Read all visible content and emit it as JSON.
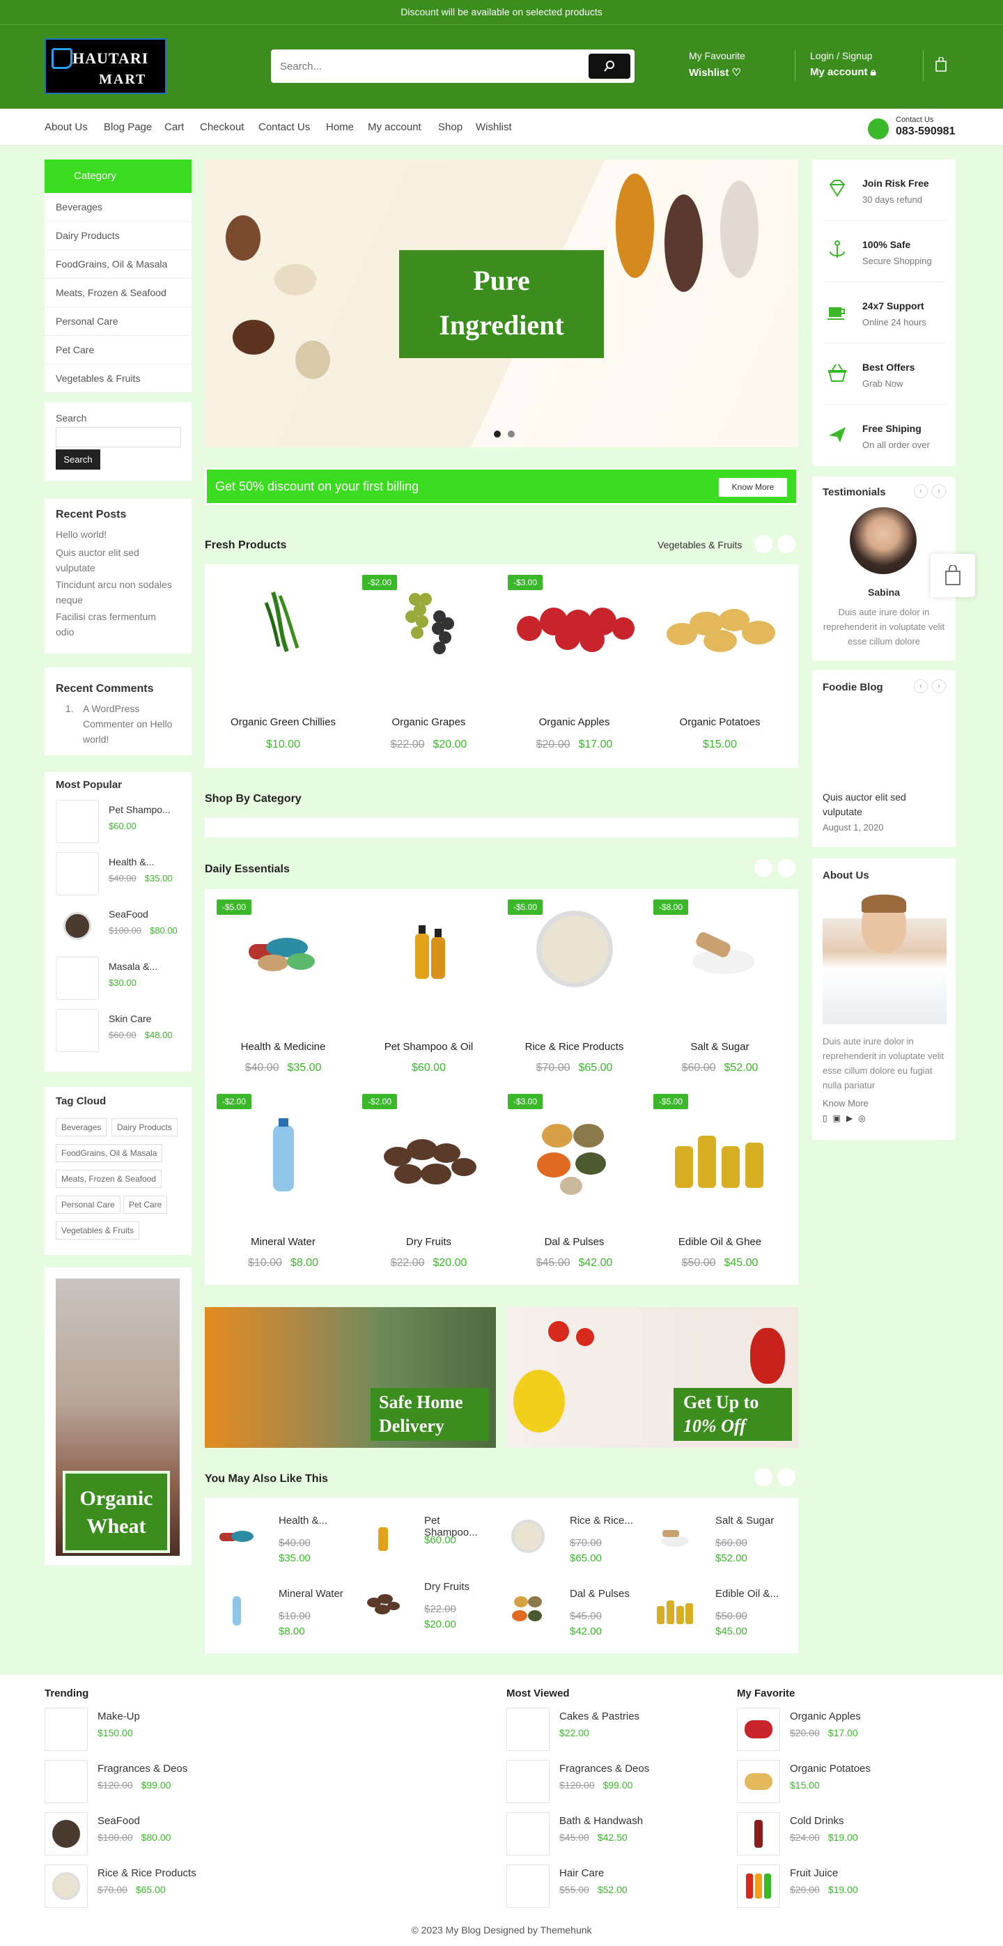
{
  "topbar": {
    "text": "Discount will be available on selected products"
  },
  "header": {
    "logo_line1": "HAUTARI",
    "logo_line2": "MART",
    "search_placeholder": "Search...",
    "wishlist_small": "My Favourite",
    "wishlist_big": "Wishlist",
    "account_small": "Login / Signup",
    "account_big": "My account"
  },
  "nav": {
    "items": [
      "About Us",
      "Blog Page",
      "Cart",
      "Checkout",
      "Contact Us",
      "Home",
      "My account",
      "Shop",
      "Wishlist"
    ],
    "contact_label": "Contact Us",
    "contact_phone": "083-590981"
  },
  "sidebar": {
    "category_title": "Category",
    "categories": [
      "Beverages",
      "Dairy Products",
      "FoodGrains, Oil & Masala",
      "Meats, Frozen & Seafood",
      "Personal Care",
      "Pet Care",
      "Vegetables & Fruits"
    ],
    "search_label": "Search",
    "search_button": "Search",
    "recent_posts_title": "Recent Posts",
    "recent_posts": [
      "Hello world!",
      "Quis auctor elit sed vulputate",
      "Tincidunt arcu non sodales neque",
      "Facilisi cras fermentum odio"
    ],
    "recent_comments_title": "Recent Comments",
    "recent_comment": "A WordPress Commenter on Hello world!",
    "most_popular_title": "Most Popular",
    "most_popular": [
      {
        "name": "Pet Shampo...",
        "old": "",
        "price": "$60.00"
      },
      {
        "name": "Health &...",
        "old": "$40.00",
        "price": "$35.00"
      },
      {
        "name": "SeaFood",
        "old": "$100.00",
        "price": "$80.00"
      },
      {
        "name": "Masala &...",
        "old": "",
        "price": "$30.00"
      },
      {
        "name": "Skin Care",
        "old": "$60.00",
        "price": "$48.00"
      }
    ],
    "tag_cloud_title": "Tag Cloud",
    "tags": [
      "Beverages",
      "Dairy Products",
      "FoodGrains, Oil & Masala",
      "Meats, Frozen & Seafood",
      "Personal Care",
      "Pet Care",
      "Vegetables & Fruits"
    ],
    "promo_text": "Organic Wheat"
  },
  "hero": {
    "title": "Pure Ingredient"
  },
  "discount_bar": {
    "text": "Get 50% discount on your first billing",
    "button": "Know More"
  },
  "fresh": {
    "title": "Fresh Products",
    "filter": "Vegetables & Fruits",
    "items": [
      {
        "name": "Organic Green Chillies",
        "old": "",
        "price": "$10.00",
        "badge": ""
      },
      {
        "name": "Organic Grapes",
        "old": "$22.00",
        "price": "$20.00",
        "badge": "-$2.00"
      },
      {
        "name": "Organic Apples",
        "old": "$20.00",
        "price": "$17.00",
        "badge": "-$3.00"
      },
      {
        "name": "Organic Potatoes",
        "old": "",
        "price": "$15.00",
        "badge": ""
      }
    ]
  },
  "shop_by_category": {
    "title": "Shop By Category"
  },
  "daily": {
    "title": "Daily Essentials",
    "items": [
      {
        "name": "Health & Medicine",
        "old": "$40.00",
        "price": "$35.00",
        "badge": "-$5.00"
      },
      {
        "name": "Pet Shampoo & Oil",
        "old": "",
        "price": "$60.00",
        "badge": ""
      },
      {
        "name": "Rice & Rice Products",
        "old": "$70.00",
        "price": "$65.00",
        "badge": "-$5.00"
      },
      {
        "name": "Salt & Sugar",
        "old": "$60.00",
        "price": "$52.00",
        "badge": "-$8.00"
      },
      {
        "name": "Mineral Water",
        "old": "$10.00",
        "price": "$8.00",
        "badge": "-$2.00"
      },
      {
        "name": "Dry Fruits",
        "old": "$22.00",
        "price": "$20.00",
        "badge": "-$2.00"
      },
      {
        "name": "Dal & Pulses",
        "old": "$45.00",
        "price": "$42.00",
        "badge": "-$3.00"
      },
      {
        "name": "Edible Oil & Ghee",
        "old": "$50.00",
        "price": "$45.00",
        "badge": "-$5.00"
      }
    ]
  },
  "banners": {
    "left": "Safe Home Delivery",
    "right_line1": "Get Up to",
    "right_line2": "10% Off"
  },
  "also_like": {
    "title": "You May Also Like This",
    "items": [
      {
        "name": "Health &...",
        "old": "$40.00",
        "price": "$35.00"
      },
      {
        "name": "Pet Shampoo...",
        "old": "",
        "price": "$60.00"
      },
      {
        "name": "Rice & Rice...",
        "old": "$70.00",
        "price": "$65.00"
      },
      {
        "name": "Salt & Sugar",
        "old": "$60.00",
        "price": "$52.00"
      },
      {
        "name": "Mineral Water",
        "old": "$10.00",
        "price": "$8.00"
      },
      {
        "name": "Dry Fruits",
        "old": "$22.00",
        "price": "$20.00"
      },
      {
        "name": "Dal & Pulses",
        "old": "$45.00",
        "price": "$42.00"
      },
      {
        "name": "Edible Oil &...",
        "old": "$50.00",
        "price": "$45.00"
      }
    ]
  },
  "right": {
    "features": [
      {
        "title": "Join Risk Free",
        "sub": "30 days refund"
      },
      {
        "title": "100% Safe",
        "sub": "Secure Shopping"
      },
      {
        "title": "24x7 Support",
        "sub": "Online 24 hours"
      },
      {
        "title": "Best Offers",
        "sub": "Grab Now"
      },
      {
        "title": "Free Shiping",
        "sub": "On all order over"
      }
    ],
    "testimonials_title": "Testimonials",
    "testimonial_name": "Sabina",
    "testimonial_text": "Duis aute irure dolor in reprehenderit in voluptate velit esse cillum dolore",
    "blog_title": "Foodie Blog",
    "blog_post": "Quis auctor elit sed vulputate",
    "blog_date": "August 1, 2020",
    "about_title": "About Us",
    "about_text": "Duis aute irure dolor in reprehenderit in voluptate velit esse cillum dolore eu fugiat nulla pariatur",
    "about_link": "Know More"
  },
  "footer": {
    "trending_title": "Trending",
    "viewed_title": "Most Viewed",
    "fav_title": "My Favorite",
    "trending": [
      {
        "name": "Make-Up",
        "old": "",
        "price": "$150.00"
      },
      {
        "name": "Fragrances & Deos",
        "old": "$120.00",
        "price": "$99.00"
      },
      {
        "name": "SeaFood",
        "old": "$100.00",
        "price": "$80.00"
      },
      {
        "name": "Rice & Rice Products",
        "old": "$70.00",
        "price": "$65.00"
      }
    ],
    "viewed": [
      {
        "name": "Cakes & Pastries",
        "old": "",
        "price": "$22.00"
      },
      {
        "name": "Fragrances & Deos",
        "old": "$120.00",
        "price": "$99.00"
      },
      {
        "name": "Bath & Handwash",
        "old": "$45.00",
        "price": "$42.50"
      },
      {
        "name": "Hair Care",
        "old": "$55.00",
        "price": "$52.00"
      }
    ],
    "fav": [
      {
        "name": "Organic Apples",
        "old": "$20.00",
        "price": "$17.00"
      },
      {
        "name": "Organic Potatoes",
        "old": "",
        "price": "$15.00"
      },
      {
        "name": "Cold Drinks",
        "old": "$24.00",
        "price": "$19.00"
      },
      {
        "name": "Fruit Juice",
        "old": "$20.00",
        "price": "$19.00"
      }
    ],
    "copyright": "© 2023 My Blog Designed by Themehunk"
  },
  "colors": {
    "primary": "#3b8e1e",
    "accent": "#3bdc1f",
    "price": "#3bb82a",
    "bg": "#e6fbdf"
  }
}
